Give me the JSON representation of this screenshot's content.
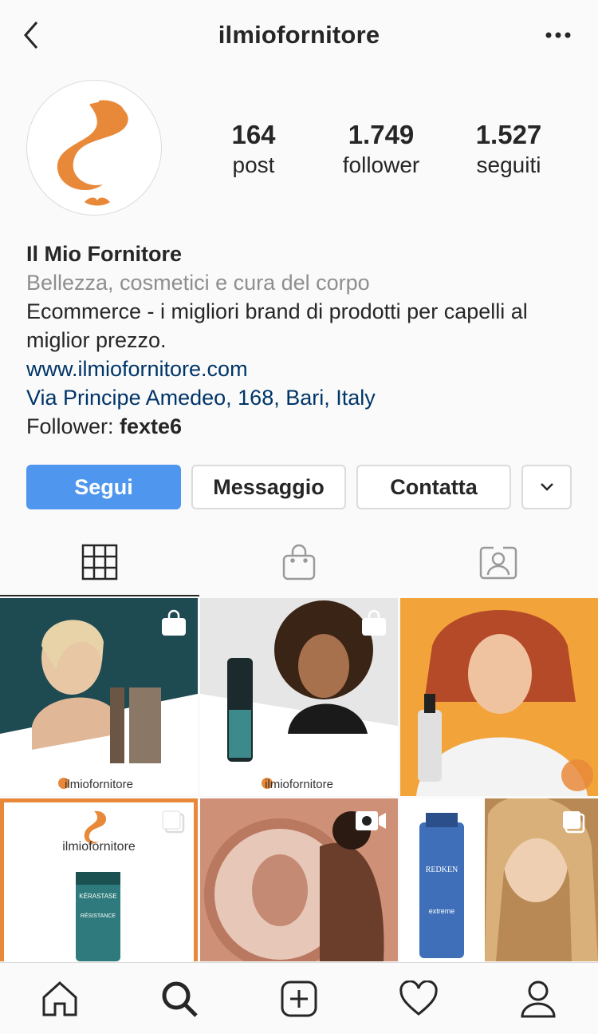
{
  "header": {
    "username": "ilmiofornitore"
  },
  "stats": [
    {
      "value": "164",
      "label": "post"
    },
    {
      "value": "1.749",
      "label": "follower"
    },
    {
      "value": "1.527",
      "label": "seguiti"
    }
  ],
  "bio": {
    "name": "Il Mio Fornitore",
    "category": "Bellezza, cosmetici e cura del corpo",
    "description": "Ecommerce - i migliori brand di prodotti per capelli al miglior prezzo.",
    "website": "www.ilmiofornitore.com",
    "address": "Via Principe Amedeo, 168, Bari, Italy",
    "followed_by_prefix": "Follower: ",
    "followed_by_user": "fexte6"
  },
  "actions": {
    "follow": "Segui",
    "message": "Messaggio",
    "contact": "Contatta"
  },
  "grid": {
    "watermark": "ilmiofornitore",
    "post_brand_text": "ilmiofornitore",
    "products": {
      "kerastase": "KÉRASTASE",
      "kerastase_line": "RÉSISTANCE",
      "redken": "REDKEN",
      "redken_line": "extreme"
    }
  },
  "colors": {
    "accent": "#4f97ee",
    "brand_orange": "#e8893a",
    "link": "#003569",
    "muted": "#8e8e8e"
  },
  "icons": {
    "tabs": [
      "grid-icon",
      "shopping-bag-icon",
      "tagged-person-icon"
    ],
    "nav": [
      "home-icon",
      "search-icon",
      "new-post-icon",
      "activity-heart-icon",
      "profile-icon"
    ]
  }
}
